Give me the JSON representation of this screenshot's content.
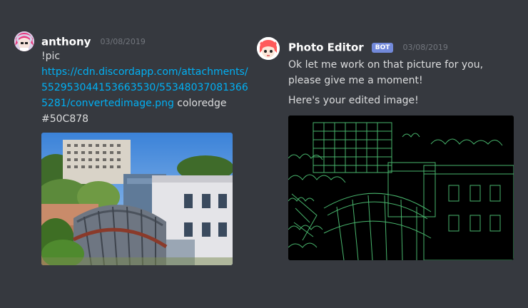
{
  "messages": [
    {
      "username": "anthony",
      "timestamp": "03/08/2019",
      "command": "!pic",
      "link_lines": [
        "https://cdn.discordapp.com/attachments/",
        "552953044153663530/55348037081366",
        "5281/convertedimage.png"
      ],
      "args_after_link": "coloredge",
      "color_arg": "#50C878",
      "attachment_icon": "photo-attachment"
    },
    {
      "username": "Photo Editor",
      "badge": "BOT",
      "timestamp": "03/08/2019",
      "text_lines": [
        "Ok let me work on that picture for you,",
        "please give me a moment!"
      ],
      "second_text": "Here's your edited image!",
      "attachment_icon": "edited-image-attachment"
    }
  ],
  "colors": {
    "background": "#36393f",
    "link": "#00b0f4",
    "bot_badge": "#7289da",
    "edge_color": "#50C878"
  }
}
